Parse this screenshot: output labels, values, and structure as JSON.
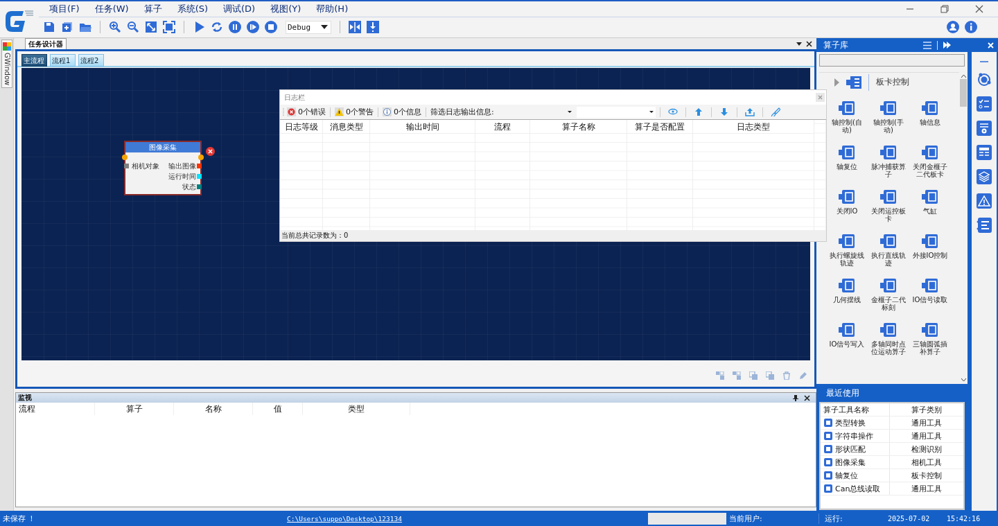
{
  "menu": [
    {
      "label": "项目(F)"
    },
    {
      "label": "任务(W)"
    },
    {
      "label": "算子"
    },
    {
      "label": "系统(S)"
    },
    {
      "label": "调试(D)"
    },
    {
      "label": "视图(Y)"
    },
    {
      "label": "帮助(H)"
    }
  ],
  "toolbar": {
    "mode_select": {
      "value": "Debug"
    }
  },
  "side_tab": {
    "label": "GWindow"
  },
  "designer": {
    "title": "任务设计器",
    "flow_tabs": [
      {
        "label": "主流程",
        "selected": true
      },
      {
        "label": "流程1",
        "selected": false
      },
      {
        "label": "流程2",
        "selected": false
      }
    ],
    "nodes": [
      {
        "title": "图像采集",
        "inputs": [
          {
            "label": "相机对象",
            "color": "#808080"
          }
        ],
        "outputs": [
          {
            "label": "输出图像",
            "color": "#ff3300"
          },
          {
            "label": "运行时间",
            "color": "#00e5ff"
          },
          {
            "label": "状态",
            "color": "#008080"
          }
        ]
      }
    ]
  },
  "log_panel": {
    "title": "日志栏",
    "counters": [
      {
        "kind": "error",
        "label": "0个错误"
      },
      {
        "kind": "warning",
        "label": "0个警告"
      },
      {
        "kind": "info",
        "label": "0个信息"
      }
    ],
    "filter_label": "筛选日志输出信息:",
    "columns": [
      "日志等级",
      "消息类型",
      "输出时间",
      "流程",
      "算子名称",
      "算子是否配置",
      "日志类型"
    ],
    "footer": "当前总共记录数为：0"
  },
  "monitor": {
    "title": "监视",
    "columns": [
      "流程",
      "算子",
      "名称",
      "值",
      "类型"
    ]
  },
  "operator_library": {
    "title": "算子库",
    "category": "板卡控制",
    "items": [
      {
        "label": "轴控制(自动)"
      },
      {
        "label": "轴控制(手动)"
      },
      {
        "label": "轴信息"
      },
      {
        "label": "轴复位"
      },
      {
        "label": "脉冲捕获算子"
      },
      {
        "label": "关闭金榧子二代板卡"
      },
      {
        "label": "关闭IO"
      },
      {
        "label": "关闭运控板卡"
      },
      {
        "label": "气缸"
      },
      {
        "label": "执行螺旋线轨迹"
      },
      {
        "label": "执行直线轨迹"
      },
      {
        "label": "外接IO控制"
      },
      {
        "label": "几何摆线"
      },
      {
        "label": "金榧子二代标刻"
      },
      {
        "label": "IO信号读取"
      },
      {
        "label": "IO信号写入"
      },
      {
        "label": "多轴同时点位运动算子"
      },
      {
        "label": "三轴圆弧插补算子"
      }
    ]
  },
  "recent": {
    "title": "最近使用",
    "columns": [
      "算子工具名称",
      "算子类别"
    ],
    "rows": [
      {
        "name": "类型转换",
        "category": "通用工具"
      },
      {
        "name": "字符串操作",
        "category": "通用工具"
      },
      {
        "name": "形状匹配",
        "category": "检测识别"
      },
      {
        "name": "图像采集",
        "category": "相机工具"
      },
      {
        "name": "轴复位",
        "category": "板卡控制"
      },
      {
        "name": "Can总线读取",
        "category": "通用工具"
      }
    ]
  },
  "status_bar": {
    "save_state": "未保存 ！",
    "path": "C:\\Users\\suppo\\Desktop\\123134",
    "user_label": "当前用户:",
    "run_label": "运行:",
    "date": "2025-07-02",
    "time": "15:42:16"
  }
}
